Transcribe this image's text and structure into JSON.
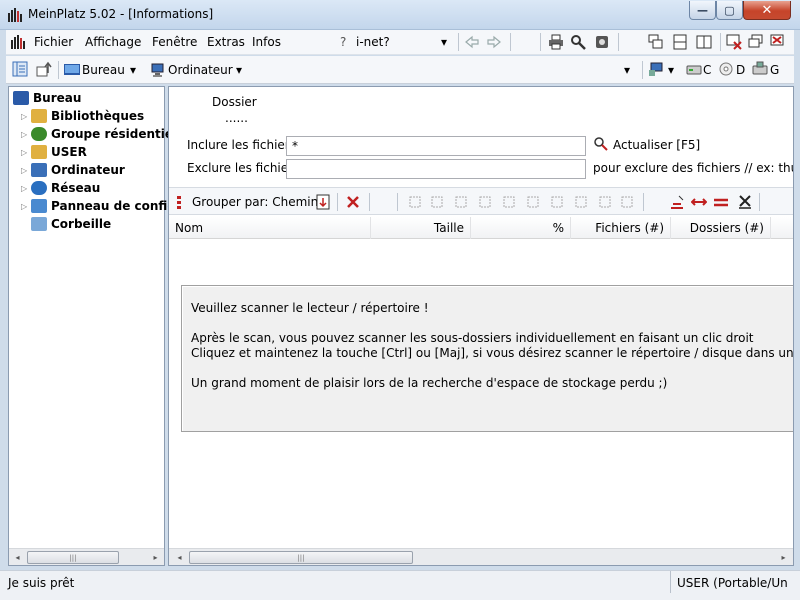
{
  "window": {
    "title": "MeinPlatz 5.02 - [Informations]",
    "min_glyph": "—",
    "max_glyph": "▢",
    "close_glyph": "✕"
  },
  "menu": {
    "items": [
      "Fichier",
      "Affichage",
      "Fenêtre",
      "Extras",
      "Infos"
    ],
    "help_glyph": "?",
    "inet_label": "i-net?",
    "dropdown_glyph": "▾"
  },
  "toolbar": {
    "bureau_label": "Bureau",
    "ordinateur_label": "Ordinateur",
    "drive_c": "C",
    "drive_d": "D",
    "drive_g": "G",
    "dropdown_glyph": "▾"
  },
  "tree": {
    "items": [
      {
        "label": "Bureau",
        "icon": "desktop-icon",
        "color": "#2a5aa8"
      },
      {
        "label": "Bibliothèques",
        "icon": "libraries-icon",
        "color": "#e0b040"
      },
      {
        "label": "Groupe résidentiel",
        "icon": "homegroup-icon",
        "color": "#3a8a2a"
      },
      {
        "label": "USER",
        "icon": "user-folder-icon",
        "color": "#e0b040"
      },
      {
        "label": "Ordinateur",
        "icon": "computer-icon",
        "color": "#3a6fb8"
      },
      {
        "label": "Réseau",
        "icon": "network-icon",
        "color": "#2a6fc0"
      },
      {
        "label": "Panneau de configu",
        "icon": "control-panel-icon",
        "color": "#4a8ad0"
      },
      {
        "label": "Corbeille",
        "icon": "recycle-bin-icon",
        "color": "#7aa8d8"
      }
    ],
    "expand_glyph": "▷"
  },
  "panel": {
    "folder_label": "Dossier",
    "folder_value": "......",
    "include_label": "Inclure les fichiers",
    "include_value": "*",
    "exclude_label": "Exclure les fichiers",
    "exclude_value": "",
    "refresh_label": "Actualiser [F5]",
    "exclude_hint": "pour exclure des fichiers // ex: thumbs",
    "group_by_label": "Grouper par: Chemin"
  },
  "columns": [
    "Nom",
    "Taille",
    "%",
    "Fichiers (#)",
    "Dossiers (#)"
  ],
  "message": {
    "line1": "Veuillez scanner le lecteur / répertoire !",
    "line2": "Après le scan, vous pouvez scanner les sous-dossiers individuellement en faisant un clic droit",
    "line3": "Cliquez et maintenez la touche [Ctrl] ou [Maj], si vous désirez scanner le répertoire / disque dans une nouvelle fenêtre",
    "line4": "Un grand moment de plaisir lors de la recherche d'espace de stockage perdu ;)"
  },
  "scroll": {
    "left_glyph": "◂",
    "right_glyph": "▸",
    "grip_glyph": "|||"
  },
  "status": {
    "left": "Je suis prêt",
    "right": "USER (Portable/Un"
  }
}
